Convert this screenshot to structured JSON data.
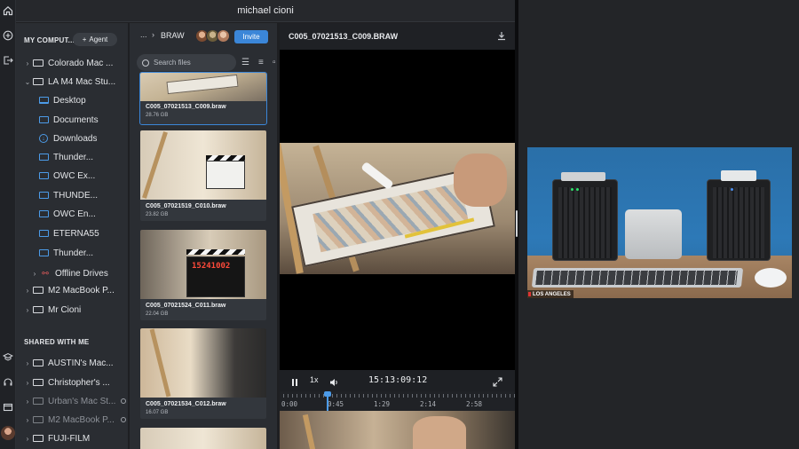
{
  "window": {
    "title": "michael cioni"
  },
  "rail": {
    "icons": [
      "home-icon",
      "plus-circle-icon",
      "exit-icon",
      "learn-icon",
      "headset-icon",
      "window-icon"
    ]
  },
  "sidebar": {
    "my_computers_label": "MY COMPUT...",
    "agent_label": "Agent",
    "my_computers": [
      {
        "label": "Colorado Mac ...",
        "icon": "drive-icon",
        "chevron": "›"
      },
      {
        "label": "LA M4 Mac Stu...",
        "icon": "drive-icon",
        "chevron": "⌄"
      },
      {
        "label": "Desktop",
        "icon": "desktop-icon"
      },
      {
        "label": "Documents",
        "icon": "folder-icon"
      },
      {
        "label": "Downloads",
        "icon": "download-circle-icon"
      },
      {
        "label": "Thunder...",
        "icon": "folder-icon"
      },
      {
        "label": "OWC Ex...",
        "icon": "folder-icon"
      },
      {
        "label": "THUNDE...",
        "icon": "folder-icon"
      },
      {
        "label": "OWC En...",
        "icon": "folder-icon"
      },
      {
        "label": "ETERNA55",
        "icon": "folder-icon"
      },
      {
        "label": "Thunder...",
        "icon": "folder-icon"
      },
      {
        "label": "Offline Drives",
        "icon": "offline-icon",
        "chevron": "›"
      },
      {
        "label": "M2 MacBook P...",
        "icon": "drive-icon",
        "chevron": "›"
      },
      {
        "label": "Mr Cioni",
        "icon": "drive-icon",
        "chevron": "›"
      }
    ],
    "shared_label": "SHARED WITH ME",
    "shared": [
      {
        "label": "AUSTIN's Mac...",
        "dim": false
      },
      {
        "label": "Christopher's ...",
        "dim": false
      },
      {
        "label": "Urban's Mac St...",
        "dim": true
      },
      {
        "label": "M2 MacBook P...",
        "dim": true
      },
      {
        "label": "FUJI-FILM",
        "dim": false
      }
    ]
  },
  "files": {
    "breadcrumb_ellipsis": "...",
    "breadcrumb_sep": "›",
    "folder": "BRAW",
    "invite_label": "Invite",
    "search_placeholder": "Search files",
    "items": [
      {
        "name": "C005_07021513_C009.braw",
        "size": "28.76 GB",
        "selected": true
      },
      {
        "name": "C005_07021519_C010.braw",
        "size": "23.82 GB",
        "selected": false
      },
      {
        "name": "C005_07021524_C011.braw",
        "size": "22.04 GB",
        "selected": false
      },
      {
        "name": "C005_07021534_C012.braw",
        "size": "16.07 GB",
        "selected": false
      }
    ]
  },
  "viewer": {
    "title": "C005_07021513_C009.BRAW",
    "speed": "1x",
    "timecode": "15:13:09:12",
    "timeline_labels": [
      "0:00",
      "0:45",
      "1:29",
      "2:14",
      "2:58"
    ],
    "playhead_fraction": 0.2
  },
  "webcam": {
    "label": "LOS ANGELES"
  }
}
